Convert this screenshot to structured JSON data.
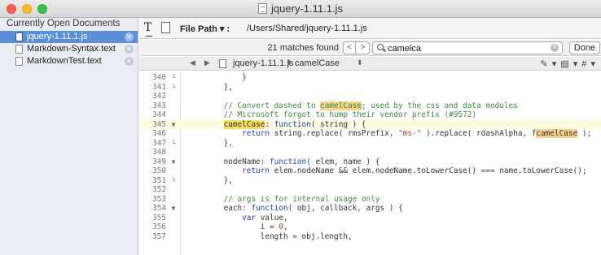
{
  "window": {
    "title": "jquery-1.11.1.js"
  },
  "sidebar": {
    "header": "Currently Open Documents",
    "items": [
      {
        "label": "jquery-1.11.1.js",
        "selected": true
      },
      {
        "label": "Markdown-Syntax.text",
        "selected": false
      },
      {
        "label": "MarkdownTest.text",
        "selected": false
      }
    ]
  },
  "header": {
    "file_path_label": "File Path ▾ :",
    "file_path_value": "/Users/Shared/jquery-1.11.1.js"
  },
  "find": {
    "matches": "21 matches found",
    "query": "camelca",
    "done_label": "Done",
    "prev_label": "<",
    "next_label": ">"
  },
  "jumpbar": {
    "file": "jquery-1.11.1.js",
    "symbol": "camelCase",
    "tools": "✎ ▾ ▤ ▾ # ▾"
  },
  "code": {
    "current_line": 345,
    "highlight_color": "#f7e15a",
    "lines": [
      {
        "n": "340",
        "fold": "└",
        "t": "\t\t}"
      },
      {
        "n": "341",
        "fold": "└",
        "t": "\t},"
      },
      {
        "n": "342",
        "fold": "",
        "t": ""
      },
      {
        "n": "343",
        "fold": "",
        "t": "\t// Convert dashed to camelCase; used by the css and data modules"
      },
      {
        "n": "344",
        "fold": "",
        "t": "\t// Microsoft forgot to hump their vendor prefix (#9572)"
      },
      {
        "n": "345",
        "fold": "▼",
        "t": "\tcamelCase: function( string ) {"
      },
      {
        "n": "346",
        "fold": "",
        "t": "\t\treturn string.replace( rmsPrefix, \"ms-\" ).replace( rdashAlpha, fcamelCase );"
      },
      {
        "n": "347",
        "fold": "└",
        "t": "\t},"
      },
      {
        "n": "348",
        "fold": "",
        "t": ""
      },
      {
        "n": "349",
        "fold": "▼",
        "t": "\tnodeName: function( elem, name ) {"
      },
      {
        "n": "350",
        "fold": "",
        "t": "\t\treturn elem.nodeName && elem.nodeName.toLowerCase() === name.toLowerCase();"
      },
      {
        "n": "351",
        "fold": "└",
        "t": "\t},"
      },
      {
        "n": "352",
        "fold": "",
        "t": ""
      },
      {
        "n": "353",
        "fold": "",
        "t": "\t// args is for internal usage only"
      },
      {
        "n": "354",
        "fold": "▼",
        "t": "\teach: function( obj, callback, args ) {"
      },
      {
        "n": "355",
        "fold": "",
        "t": "\t\tvar value,"
      },
      {
        "n": "356",
        "fold": "",
        "t": "\t\t\ti = 0,"
      },
      {
        "n": "357",
        "fold": "",
        "t": "\t\t\tlength = obj.length,"
      }
    ]
  }
}
